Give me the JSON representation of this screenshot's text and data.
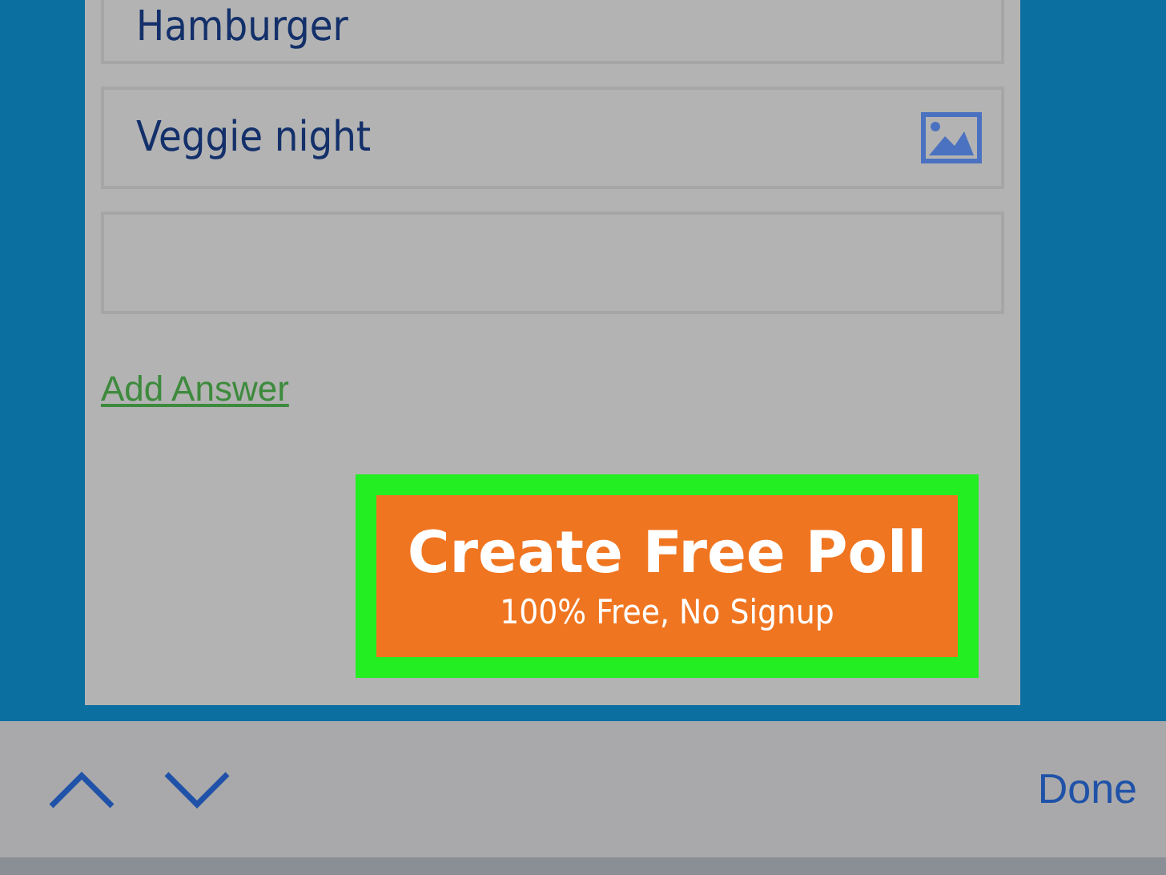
{
  "answers": [
    {
      "value": "Hamburger",
      "image_icon": false
    },
    {
      "value": "Veggie night",
      "image_icon": true
    },
    {
      "image_icon": false
    }
  ],
  "add_answer_link": "Add Answer",
  "create_button": {
    "title": "Create Free Poll",
    "subtitle": "100% Free, No Signup",
    "highlighted": true
  },
  "keyboard_bar": {
    "done": "Done"
  }
}
